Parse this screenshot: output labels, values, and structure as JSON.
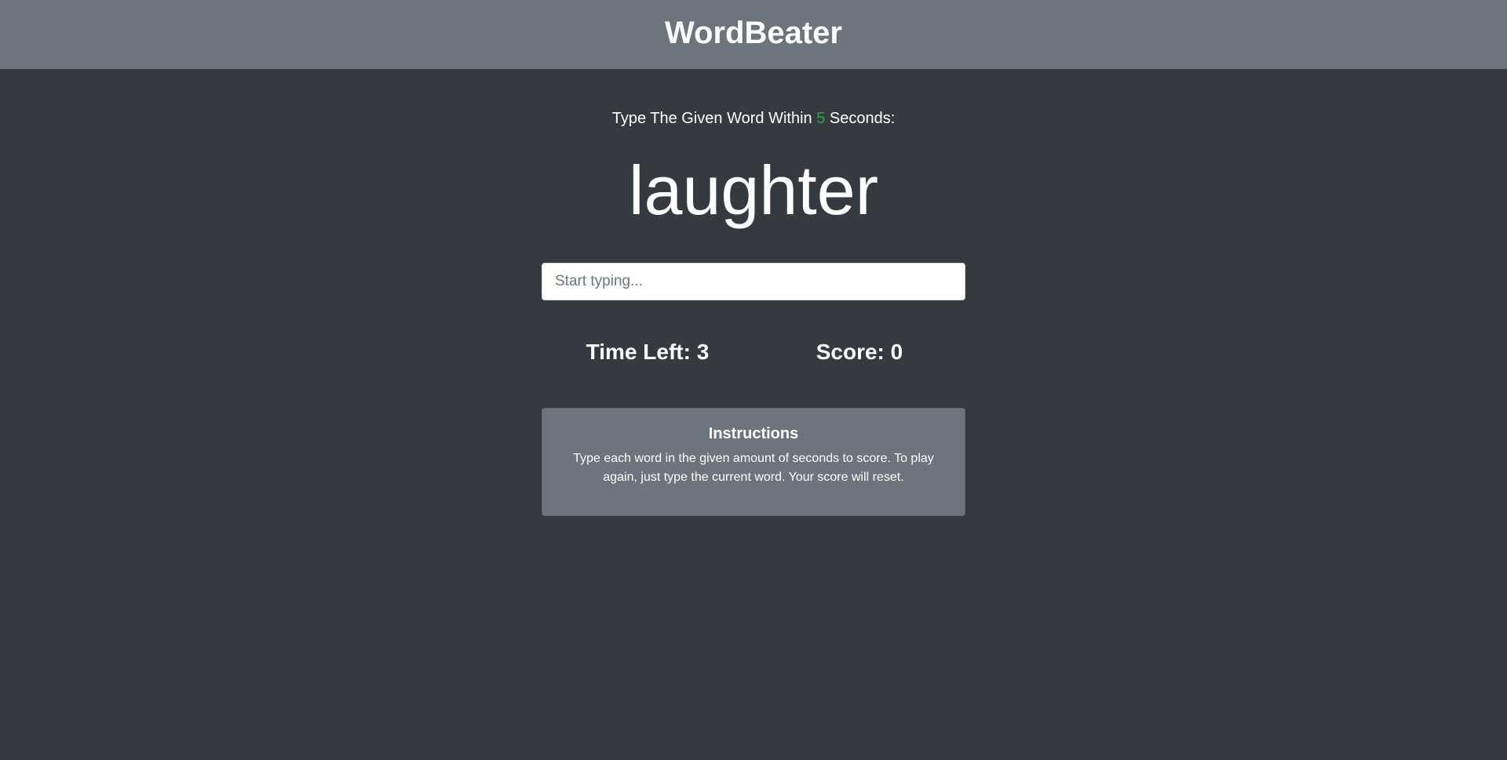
{
  "header": {
    "title": "WordBeater"
  },
  "prompt": {
    "prefix": "Type The Given Word Within ",
    "seconds": "5",
    "suffix": " Seconds:"
  },
  "game": {
    "current_word": "laughter",
    "input_placeholder": "Start typing...",
    "input_value": ""
  },
  "stats": {
    "time_label": "Time Left: ",
    "time_value": "3",
    "score_label": "Score: ",
    "score_value": "0"
  },
  "instructions": {
    "title": "Instructions",
    "text": "Type each word in the given amount of seconds to score. To play again, just type the current word. Your score will reset."
  },
  "colors": {
    "background": "#343a40",
    "header": "#6c757d",
    "seconds_accent": "#28a745",
    "card": "#6c757d"
  }
}
